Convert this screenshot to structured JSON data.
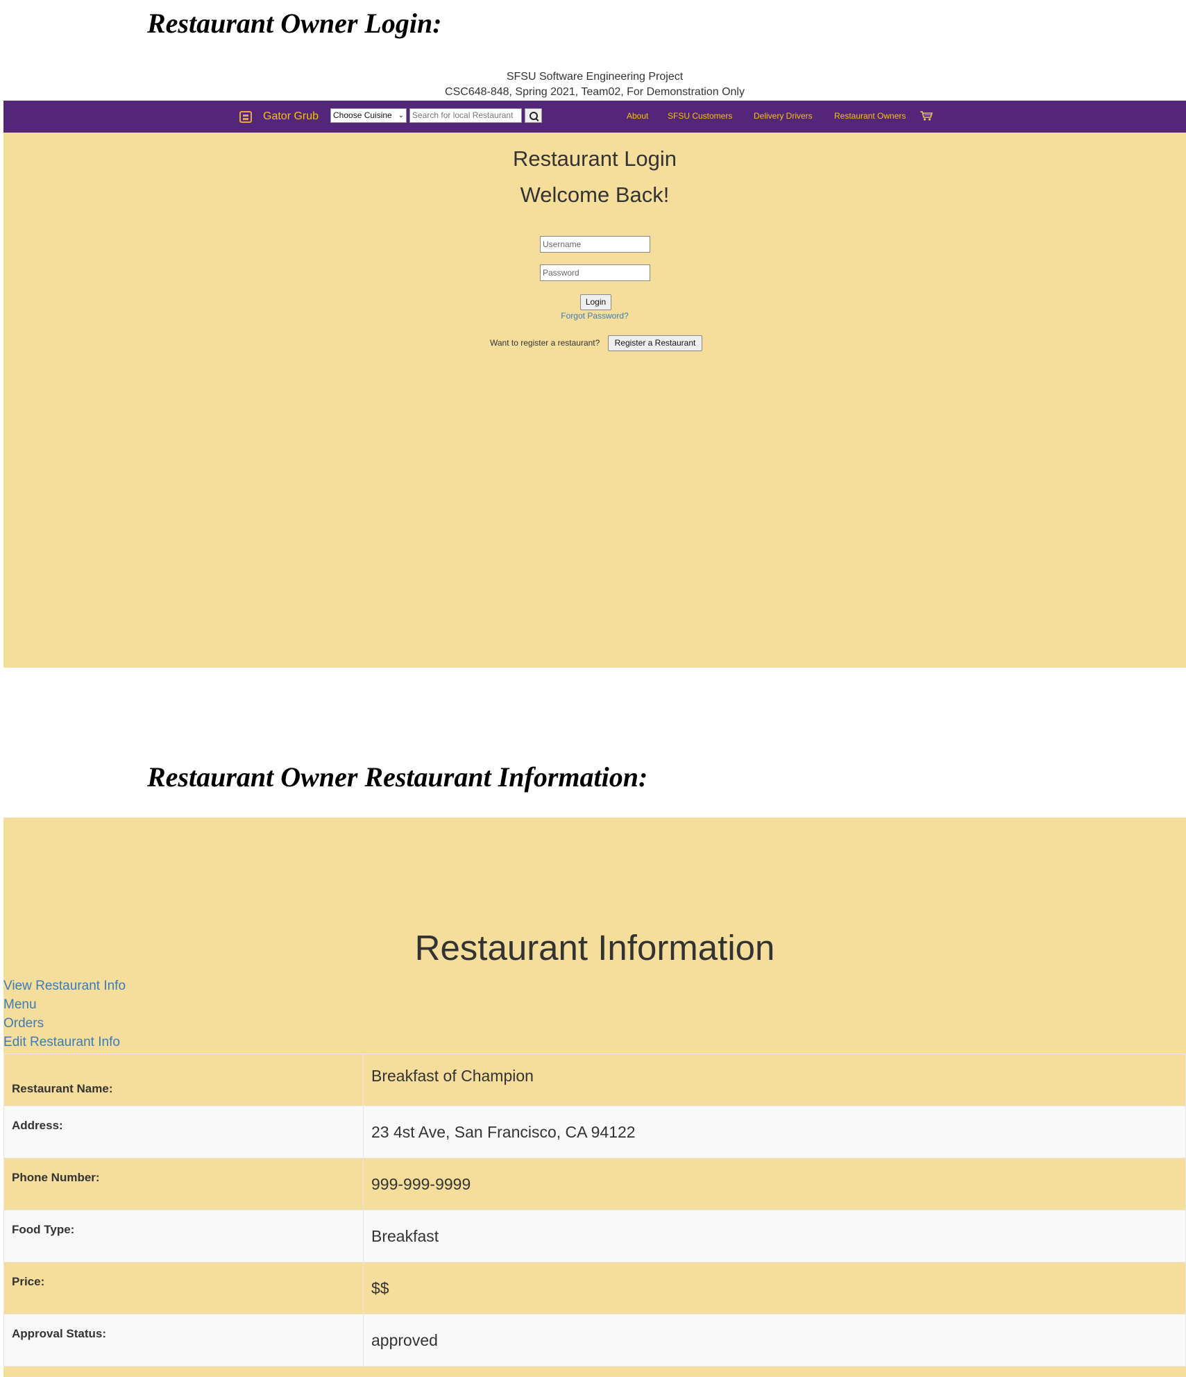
{
  "doc": {
    "heading_login": "Restaurant Owner Login:",
    "heading_info": "Restaurant Owner Restaurant Information:"
  },
  "banner": {
    "line1": "SFSU Software Engineering Project",
    "line2": "CSC648-848, Spring 2021, Team02, For Demonstration Only"
  },
  "navbar": {
    "brand": "Gator Grub",
    "brand_icon": "gator-icon",
    "cuisine_selected": "Choose Cuisine",
    "search_placeholder": "Search for local Restaurant",
    "links": [
      "About",
      "SFSU Customers",
      "Delivery Drivers",
      "Restaurant Owners"
    ],
    "cart_icon": "cart-icon",
    "colors": {
      "bar": "#54267a",
      "link": "#f5c400"
    }
  },
  "login": {
    "title": "Restaurant Login",
    "welcome": "Welcome Back!",
    "username_placeholder": "Username",
    "password_placeholder": "Password",
    "login_label": "Login",
    "forgot_label": "Forgot Password?",
    "register_prompt": "Want to register a restaurant?",
    "register_label": "Register a Restaurant",
    "background": "#f5dd9b"
  },
  "info": {
    "title": "Restaurant Information",
    "nav": [
      "View Restaurant Info",
      "Menu",
      "Orders",
      "Edit Restaurant Info"
    ],
    "rows": [
      {
        "label": "Restaurant Name:",
        "value": "Breakfast of Champion"
      },
      {
        "label": "Address:",
        "value": "23 4st Ave, San Francisco, CA 94122"
      },
      {
        "label": "Phone Number:",
        "value": "999-999-9999"
      },
      {
        "label": "Food Type:",
        "value": "Breakfast"
      },
      {
        "label": "Price:",
        "value": "$$"
      },
      {
        "label": "Approval Status:",
        "value": "approved"
      }
    ]
  }
}
